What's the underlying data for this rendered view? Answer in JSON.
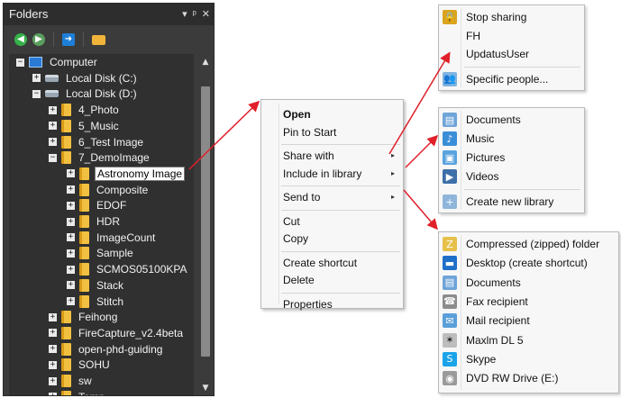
{
  "panel": {
    "title": "Folders",
    "pin_glyph": "▾",
    "dock_glyph": "ᵖ",
    "close_glyph": "✕",
    "toolbar": [
      {
        "name": "back-icon",
        "glyph": "◀"
      },
      {
        "name": "forward-icon",
        "glyph": "▶"
      },
      {
        "name": "navigate-icon",
        "glyph": "➜"
      },
      {
        "name": "open-folder-icon",
        "glyph": ""
      }
    ],
    "tree": [
      {
        "label": "Computer",
        "level": 0,
        "expander": "−",
        "icon": "pc"
      },
      {
        "label": "Local Disk (C:)",
        "level": 1,
        "expander": "+",
        "icon": "disk"
      },
      {
        "label": "Local Disk (D:)",
        "level": 1,
        "expander": "−",
        "icon": "disk"
      },
      {
        "label": "4_Photo",
        "level": 2,
        "expander": "+",
        "icon": "folder"
      },
      {
        "label": "5_Music",
        "level": 2,
        "expander": "+",
        "icon": "folder"
      },
      {
        "label": "6_Test Image",
        "level": 2,
        "expander": "+",
        "icon": "folder"
      },
      {
        "label": "7_DemoImage",
        "level": 2,
        "expander": "−",
        "icon": "folder"
      },
      {
        "label": "Astronomy Image",
        "level": 3,
        "expander": "+",
        "icon": "folder",
        "selected": true
      },
      {
        "label": "Composite",
        "level": 3,
        "expander": "+",
        "icon": "folder"
      },
      {
        "label": "EDOF",
        "level": 3,
        "expander": "+",
        "icon": "folder"
      },
      {
        "label": "HDR",
        "level": 3,
        "expander": "+",
        "icon": "folder"
      },
      {
        "label": "ImageCount",
        "level": 3,
        "expander": "+",
        "icon": "folder"
      },
      {
        "label": "Sample",
        "level": 3,
        "expander": "+",
        "icon": "folder"
      },
      {
        "label": "SCMOS05100KPA",
        "level": 3,
        "expander": "+",
        "icon": "folder"
      },
      {
        "label": "Stack",
        "level": 3,
        "expander": "+",
        "icon": "folder"
      },
      {
        "label": "Stitch",
        "level": 3,
        "expander": "+",
        "icon": "folder"
      },
      {
        "label": "Feihong",
        "level": 2,
        "expander": "+",
        "icon": "folder"
      },
      {
        "label": "FireCapture_v2.4beta",
        "level": 2,
        "expander": "+",
        "icon": "folder"
      },
      {
        "label": "open-phd-guiding",
        "level": 2,
        "expander": "+",
        "icon": "folder"
      },
      {
        "label": "SOHU",
        "level": 2,
        "expander": "+",
        "icon": "folder"
      },
      {
        "label": "sw",
        "level": 2,
        "expander": "+",
        "icon": "folder"
      },
      {
        "label": "Temp",
        "level": 2,
        "expander": "+",
        "icon": "folder"
      }
    ],
    "scroll_up": "▲",
    "scroll_down": "▼"
  },
  "context_menu": {
    "items": [
      {
        "label": "Open",
        "bold": true
      },
      {
        "label": "Pin to Start"
      },
      {
        "sep": true
      },
      {
        "label": "Share with",
        "submenu": true
      },
      {
        "label": "Include in library",
        "submenu": true
      },
      {
        "sep": true
      },
      {
        "label": "Send to",
        "submenu": true
      },
      {
        "sep": true
      },
      {
        "label": "Cut"
      },
      {
        "label": "Copy"
      },
      {
        "sep": true
      },
      {
        "label": "Create shortcut"
      },
      {
        "label": "Delete"
      },
      {
        "sep": true
      },
      {
        "label": "Properties"
      }
    ],
    "submenu_arrow": "▸"
  },
  "share_menu": {
    "items": [
      {
        "label": "Stop sharing",
        "icon": "lock-icon",
        "icon_class": "ic-lock",
        "glyph": "🔒"
      },
      {
        "label": "FH",
        "icon": null
      },
      {
        "label": "UpdatusUser",
        "icon": null
      },
      {
        "sep": true
      },
      {
        "label": "Specific people...",
        "icon": "people-icon",
        "icon_class": "ic-people",
        "glyph": "👥"
      }
    ]
  },
  "library_menu": {
    "items": [
      {
        "label": "Documents",
        "icon": "documents-library-icon",
        "icon_class": "ic-doc",
        "glyph": "▤"
      },
      {
        "label": "Music",
        "icon": "music-library-icon",
        "icon_class": "ic-music",
        "glyph": "♪"
      },
      {
        "label": "Pictures",
        "icon": "pictures-library-icon",
        "icon_class": "ic-pic",
        "glyph": "▣"
      },
      {
        "label": "Videos",
        "icon": "videos-library-icon",
        "icon_class": "ic-vid",
        "glyph": "▶"
      },
      {
        "sep": true
      },
      {
        "label": "Create new library",
        "icon": "new-library-icon",
        "icon_class": "ic-lib",
        "glyph": "+"
      }
    ]
  },
  "sendto_menu": {
    "items": [
      {
        "label": "Compressed (zipped) folder",
        "icon": "zip-folder-icon",
        "icon_class": "ic-zip",
        "glyph": "Z"
      },
      {
        "label": "Desktop (create shortcut)",
        "icon": "desktop-icon",
        "icon_class": "ic-desk",
        "glyph": "▬"
      },
      {
        "label": "Documents",
        "icon": "documents-icon",
        "icon_class": "ic-doc",
        "glyph": "▤"
      },
      {
        "label": "Fax recipient",
        "icon": "fax-icon",
        "icon_class": "ic-fax",
        "glyph": "☎"
      },
      {
        "label": "Mail recipient",
        "icon": "mail-icon",
        "icon_class": "ic-mail",
        "glyph": "✉"
      },
      {
        "label": "Maxlm DL 5",
        "icon": "maxim-icon",
        "icon_class": "ic-maxim",
        "glyph": "✶"
      },
      {
        "label": "Skype",
        "icon": "skype-icon",
        "icon_class": "ic-skype",
        "glyph": "S"
      },
      {
        "label": "DVD RW Drive (E:)",
        "icon": "dvd-drive-icon",
        "icon_class": "ic-dvd",
        "glyph": "◉"
      }
    ]
  },
  "colors": {
    "panel_bg": "#3b3b3b",
    "arrow": "#e0202a",
    "menu_bg": "#f7f7f7"
  }
}
